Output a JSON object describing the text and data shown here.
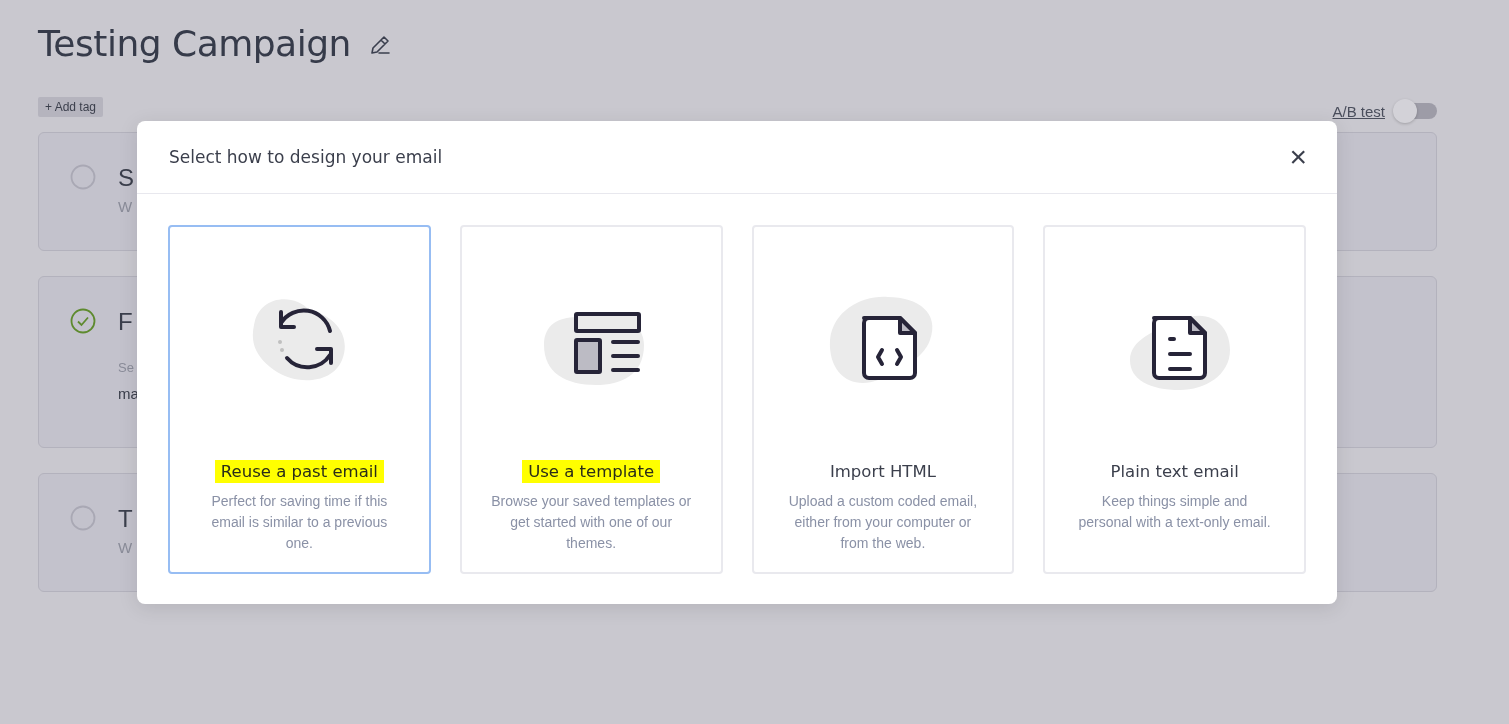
{
  "page": {
    "title": "Testing Campaign",
    "add_tag": "+ Add tag",
    "ab_test": {
      "label": "A/B test",
      "on": false
    }
  },
  "steps": [
    {
      "done": false,
      "title": "S",
      "subtitle": "W"
    },
    {
      "done": true,
      "title": "F",
      "lines": [
        "Se",
        "ma"
      ]
    },
    {
      "done": false,
      "title": "T",
      "subtitle": "W"
    }
  ],
  "modal": {
    "title": "Select how to design your email",
    "close": "×",
    "options": [
      {
        "kind": "reuse",
        "title": "Reuse a past email",
        "description": "Perfect for saving time if this email is similar to a previous one.",
        "selected": true,
        "highlighted": true
      },
      {
        "kind": "template",
        "title": "Use a template",
        "description": "Browse your saved templates or get started with one of our themes.",
        "selected": false,
        "highlighted": true
      },
      {
        "kind": "html",
        "title": "Import HTML",
        "description": "Upload a custom coded email, either from your computer or from the web.",
        "selected": false,
        "highlighted": false
      },
      {
        "kind": "plain",
        "title": "Plain text email",
        "description": "Keep things simple and personal with a text-only email.",
        "selected": false,
        "highlighted": false
      }
    ]
  }
}
